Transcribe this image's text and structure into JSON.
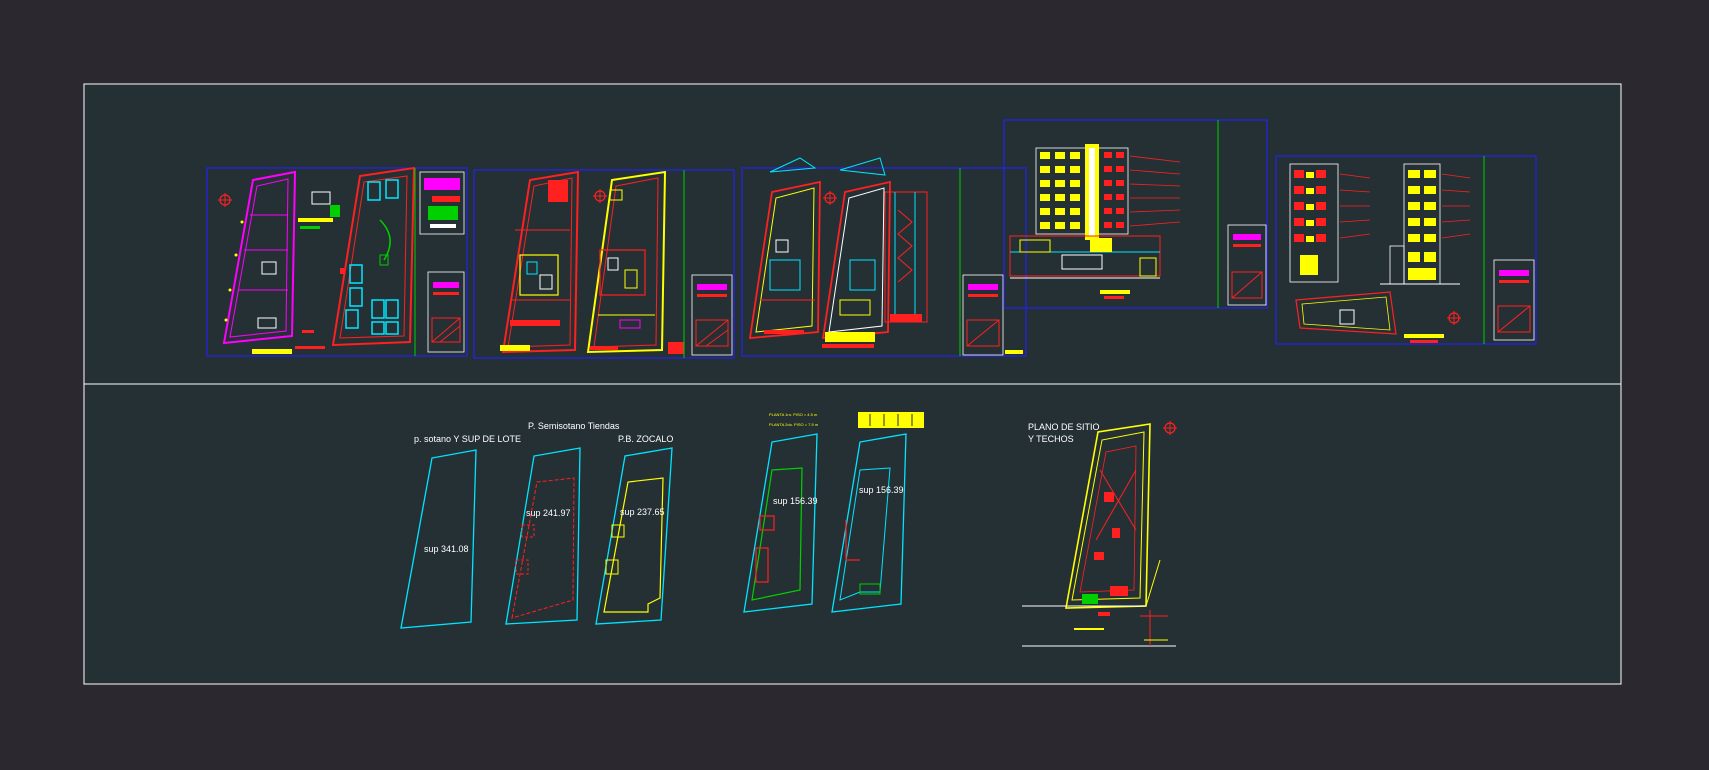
{
  "colors": {
    "background": "#2b2830",
    "model_space": "#253035",
    "frame": "#ffffff",
    "sheet_border": "#2222ee",
    "cyan": "#00e5ff",
    "red": "#ff2020",
    "yellow": "#ffff00",
    "magenta": "#ff00ff",
    "green": "#00d000"
  },
  "labels": {
    "semisotano": "P. Semisotano Tiendas",
    "sotano": "p. sotano  Y SUP DE LOTE",
    "zocalo": "P.B. ZOCALO",
    "plano_sitio_1": "PLANO DE SITIO",
    "plano_sitio_2": "Y TECHOS",
    "planta_note_1": "PLANTA 1ro. PISO = 4.5 m",
    "planta_note_2": "PLANTA 2do. PISO = 7.5 m"
  },
  "areas": {
    "sotano": "sup 341.08",
    "semisotano": "sup 241.97",
    "zocalo": "sup 237.65",
    "piso1": "sup 156.39",
    "piso2": "sup 156.39"
  },
  "sheets": [
    "sheet-site-plan",
    "sheet-basement-plans",
    "sheet-floor-plans",
    "sheet-front-elevation",
    "sheet-side-elevation"
  ]
}
